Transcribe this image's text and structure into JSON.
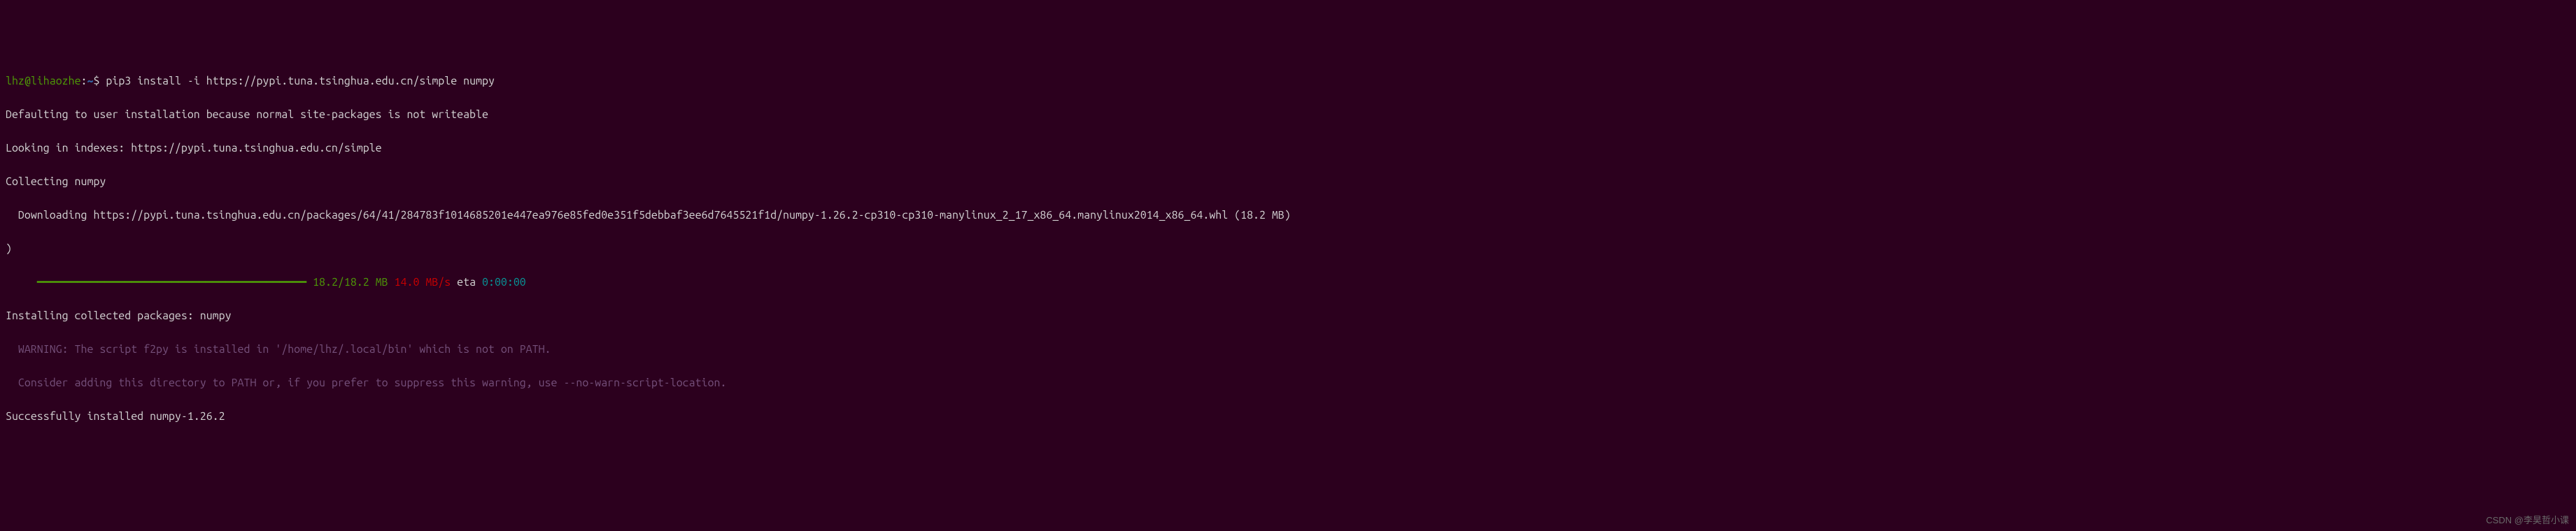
{
  "prompt": {
    "user": "lhz",
    "at": "@",
    "host": "lihaozhe",
    "sep": ":",
    "path": "~",
    "dollar": "$ "
  },
  "command": "pip3 install -i https://pypi.tuna.tsinghua.edu.cn/simple numpy",
  "lines": {
    "defaulting": "Defaulting to user installation because normal site-packages is not writeable",
    "looking": "Looking in indexes: https://pypi.tuna.tsinghua.edu.cn/simple",
    "collecting": "Collecting numpy",
    "downloading": "  Downloading https://pypi.tuna.tsinghua.edu.cn/packages/64/41/284783f1014685201e447ea976e85fed0e351f5debbaf3ee6d7645521f1d/numpy-1.26.2-cp310-cp310-manylinux_2_17_x86_64.manylinux2014_x86_64.whl (18.2 MB)",
    "installing": "Installing collected packages: numpy",
    "warning1": "  WARNING: The script f2py is installed in '/home/lhz/.local/bin' which is not on PATH.",
    "warning2": "  Consider adding this directory to PATH or, if you prefer to suppress this warning, use --no-warn-script-location.",
    "success": "Successfully installed numpy-1.26.2"
  },
  "progress": {
    "indent": "     ",
    "bar_filled": "━━━━━━━━━━━━━━━━━━━━━━━━━━━━━━━━━━━━━━━━",
    "size": " 18.2/18.2 MB",
    "speed": " 14.0 MB/s",
    "eta_label": " eta ",
    "eta": "0:00:00"
  },
  "watermark": "CSDN @李昊哲小课"
}
